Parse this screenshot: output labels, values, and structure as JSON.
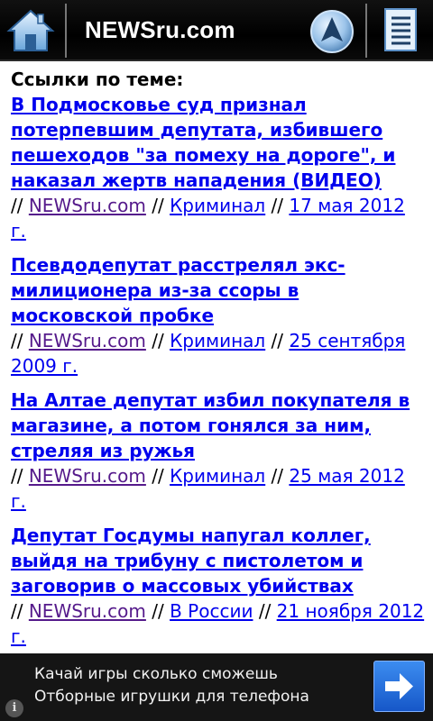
{
  "header": {
    "title": "NEWSru.com",
    "home_icon": "home-icon",
    "nav_icon": "navigation-arrow-icon",
    "menu_icon": "document-list-icon"
  },
  "content": {
    "section_title": "Ссылки по теме:",
    "separator": "//",
    "articles": [
      {
        "title": "В Подмосковье суд признал потерпевшим депутата, избившего пешеходов \"за помеху на дороге\", и наказал жертв нападения (ВИДЕО)",
        "source": "NEWSru.com",
        "category": "Криминал",
        "date": "17 мая 2012 г."
      },
      {
        "title": "Псевдодепутат расстрелял экс-милиционера из-за ссоры в московской пробке",
        "source": "NEWSru.com",
        "category": "Криминал",
        "date": "25 сентября 2009 г."
      },
      {
        "title": "На Алтае депутат избил покупателя в магазине, а потом гонялся за ним, стреляя из ружья",
        "source": "NEWSru.com",
        "category": "Криминал",
        "date": "25 мая 2012 г."
      },
      {
        "title": "Депутат Госдумы напугал коллег, выйдя на трибуну с пистолетом и заговорив о массовых убийствах",
        "source": "NEWSru.com",
        "category": "В России",
        "date": "21 ноября 2012 г."
      }
    ]
  },
  "ad": {
    "line1": "Качай игры сколько сможешь",
    "line2": "Отборные игрушки для телефона",
    "arrow_icon": "arrow-right-icon",
    "info_icon": "info-icon",
    "info_glyph": "i"
  },
  "colors": {
    "link": "#0000ee",
    "visited": "#551a8b",
    "header_bg": "#000000",
    "ad_bg": "#151515",
    "ad_button": "#2a6fdc"
  }
}
